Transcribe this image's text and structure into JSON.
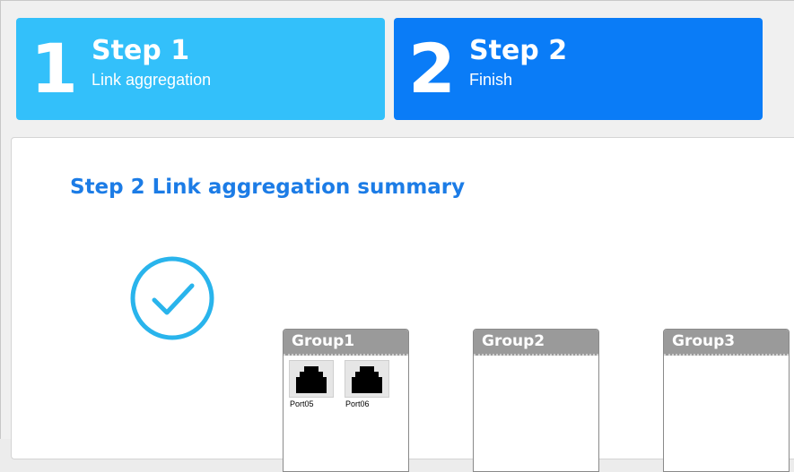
{
  "colors": {
    "step1_bg": "#33c0fa",
    "step2_bg": "#0a7cf7",
    "title_color": "#1c7ce6",
    "check_color": "#29b4ec",
    "group_header_bg": "#9a9a9a"
  },
  "steps": [
    {
      "number": "1",
      "title": "Step 1",
      "subtitle": "Link aggregation"
    },
    {
      "number": "2",
      "title": "Step 2",
      "subtitle": "Finish"
    }
  ],
  "summary": {
    "title": "Step 2 Link aggregation summary",
    "status_icon": "check-circle-icon"
  },
  "groups": [
    {
      "label": "Group1",
      "ports": [
        {
          "label": "Port05",
          "icon": "ethernet-port-icon"
        },
        {
          "label": "Port06",
          "icon": "ethernet-port-icon"
        }
      ]
    },
    {
      "label": "Group2",
      "ports": []
    },
    {
      "label": "Group3",
      "ports": []
    }
  ]
}
